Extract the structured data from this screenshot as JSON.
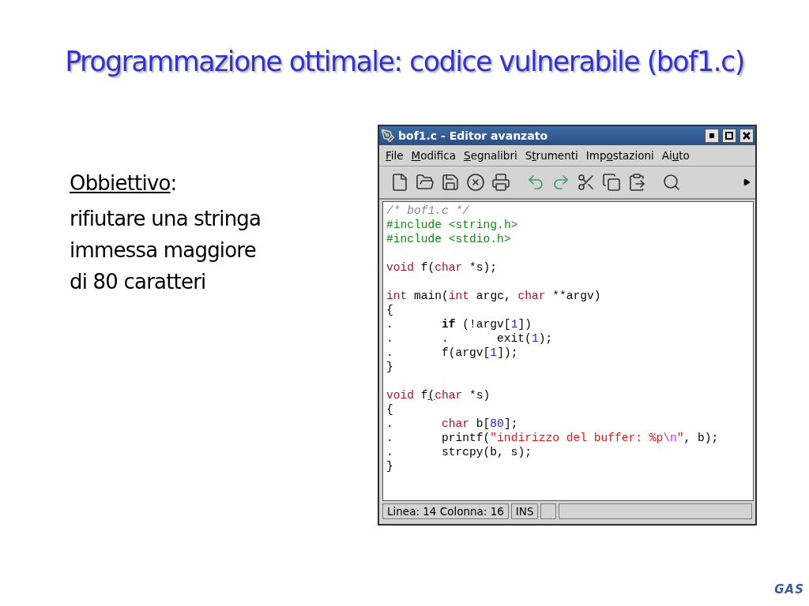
{
  "slide": {
    "title": "Programmazione ottimale: codice vulnerabile (bof1.c)",
    "objective_label": "Obbiettivo",
    "objective_colon": ":",
    "objective_text": "rifiutare una stringa immessa maggiore di 80 caratteri",
    "logo": "GAS"
  },
  "window": {
    "title": "bof1.c - Editor avanzato",
    "menu": [
      {
        "key": "F",
        "after": "ile"
      },
      {
        "key": "M",
        "after": "odifica"
      },
      {
        "key": "S",
        "after": "egnalibri"
      },
      {
        "before": "S",
        "key": "t",
        "after": "rumenti"
      },
      {
        "before": "Imp",
        "key": "o",
        "after": "stazioni"
      },
      {
        "before": "Ai",
        "key": "u",
        "after": "to"
      }
    ],
    "code_lines": [
      {
        "kind": "code",
        "tokens": [
          {
            "kind": "comment",
            "text": "/* bof1.c */"
          }
        ]
      },
      {
        "kind": "code",
        "tokens": [
          {
            "kind": "preproc",
            "text": "#include <string.h>"
          }
        ]
      },
      {
        "kind": "code",
        "tokens": [
          {
            "kind": "preproc",
            "text": "#include <stdio.h>"
          }
        ]
      },
      {
        "kind": "blank"
      },
      {
        "kind": "code",
        "tokens": [
          {
            "kind": "type",
            "text": "void"
          },
          {
            "kind": "plain",
            "text": " f("
          },
          {
            "kind": "type",
            "text": "char"
          },
          {
            "kind": "plain",
            "text": " *s);"
          }
        ]
      },
      {
        "kind": "blank"
      },
      {
        "kind": "code",
        "tokens": [
          {
            "kind": "type",
            "text": "int"
          },
          {
            "kind": "plain",
            "text": " main("
          },
          {
            "kind": "type",
            "text": "int"
          },
          {
            "kind": "plain",
            "text": " argc, "
          },
          {
            "kind": "type",
            "text": "char"
          },
          {
            "kind": "plain",
            "text": " **argv)"
          }
        ]
      },
      {
        "kind": "code",
        "tokens": [
          {
            "kind": "plain",
            "text": "{"
          }
        ]
      },
      {
        "kind": "code",
        "tokens": [
          {
            "kind": "tabmark",
            "text": "."
          },
          {
            "kind": "keyword",
            "text": "if"
          },
          {
            "kind": "plain",
            "text": " (!argv["
          },
          {
            "kind": "number",
            "text": "1"
          },
          {
            "kind": "plain",
            "text": "])"
          }
        ]
      },
      {
        "kind": "code",
        "tokens": [
          {
            "kind": "tabmark",
            "text": "."
          },
          {
            "kind": "tabmark",
            "text": "."
          },
          {
            "kind": "plain",
            "text": "exit("
          },
          {
            "kind": "number",
            "text": "1"
          },
          {
            "kind": "plain",
            "text": ");"
          }
        ]
      },
      {
        "kind": "code",
        "tokens": [
          {
            "kind": "tabmark",
            "text": "."
          },
          {
            "kind": "plain",
            "text": "f(argv["
          },
          {
            "kind": "number",
            "text": "1"
          },
          {
            "kind": "plain",
            "text": "]);"
          }
        ]
      },
      {
        "kind": "code",
        "tokens": [
          {
            "kind": "plain",
            "text": "}"
          }
        ]
      },
      {
        "kind": "blank"
      },
      {
        "kind": "code",
        "tokens": [
          {
            "kind": "type",
            "text": "void"
          },
          {
            "kind": "plain",
            "text": " f"
          },
          {
            "kind": "cursor",
            "text": "("
          },
          {
            "kind": "type",
            "text": "char"
          },
          {
            "kind": "plain",
            "text": " *s)"
          }
        ]
      },
      {
        "kind": "code",
        "tokens": [
          {
            "kind": "plain",
            "text": "{"
          }
        ]
      },
      {
        "kind": "code",
        "tokens": [
          {
            "kind": "tabmark",
            "text": "."
          },
          {
            "kind": "type",
            "text": "char"
          },
          {
            "kind": "plain",
            "text": " b["
          },
          {
            "kind": "number",
            "text": "80"
          },
          {
            "kind": "plain",
            "text": "];"
          }
        ]
      },
      {
        "kind": "code",
        "tokens": [
          {
            "kind": "tabmark",
            "text": "."
          },
          {
            "kind": "plain",
            "text": "printf("
          },
          {
            "kind": "string",
            "text": "\"indirizzo del buffer: %p"
          },
          {
            "kind": "escape",
            "text": "\\n"
          },
          {
            "kind": "string",
            "text": "\""
          },
          {
            "kind": "plain",
            "text": ", b);"
          }
        ]
      },
      {
        "kind": "code",
        "tokens": [
          {
            "kind": "tabmark",
            "text": "."
          },
          {
            "kind": "plain",
            "text": "strcpy(b, s);"
          }
        ]
      },
      {
        "kind": "code",
        "tokens": [
          {
            "kind": "plain",
            "text": "}"
          }
        ]
      }
    ],
    "status_bar": [
      {
        "kind": "text",
        "text": "Linea: 14 Colonna: 16"
      },
      {
        "kind": "text",
        "text": "INS"
      },
      {
        "kind": "empty"
      },
      {
        "kind": "spacer"
      }
    ]
  }
}
